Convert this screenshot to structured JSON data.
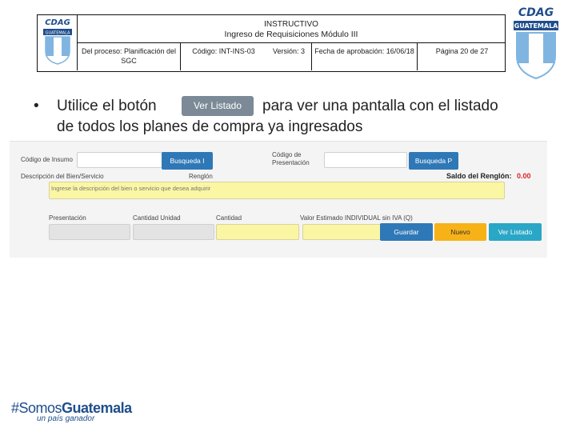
{
  "header": {
    "title_line1": "INSTRUCTIVO",
    "title_line2": "Ingreso de Requisiciones Módulo III",
    "process": "Del proceso: Planificación del SGC",
    "code": "Código: INT-INS-03",
    "version": "Versión: 3",
    "approval": "Fecha de aprobación: 16/06/18",
    "page": "Página 20 de 27"
  },
  "logos": {
    "brand": "CDAG",
    "country": "GUATEMALA"
  },
  "instruction": {
    "bullet": "•",
    "before_button": "Utilice el botón",
    "button_label": "Ver Listado",
    "after_button": "para ver una pantalla con el listado",
    "line2": "de todos los planes de compra ya ingresados"
  },
  "form": {
    "codigo_insumo_label": "Código de Insumo",
    "busqueda_i_label": "Busqueda I",
    "codigo_presentacion_label": "Código de Presentación",
    "busqueda_p_label": "Busqueda P",
    "descripcion_label": "Descripción del Bien/Servicio",
    "renglon_label": "Renglón",
    "saldo_label": "Saldo del Renglón:",
    "saldo_value": "0.00",
    "descripcion_placeholder": "Ingrese la descripción del bien o servicio que desea adquirir",
    "presentacion_label": "Presentación",
    "cantidad_unidad_label": "Cantidad Unidad",
    "cantidad_label": "Cantidad",
    "valor_estimado_label": "Valor Estimado INDIVIDUAL sin IVA (Q)",
    "guardar_label": "Guardar",
    "nuevo_label": "Nuevo",
    "ver_listado_label": "Ver Listado"
  },
  "footer": {
    "hashtag_prefix": "#Somos",
    "hashtag_suffix": "Guatemala",
    "tagline": "un país ganador"
  },
  "colors": {
    "brand_blue": "#1f4e8c",
    "button_blue": "#2f78b7",
    "button_orange": "#f7b217",
    "button_teal": "#2aa7c6",
    "saldo_red": "#d9262a"
  }
}
